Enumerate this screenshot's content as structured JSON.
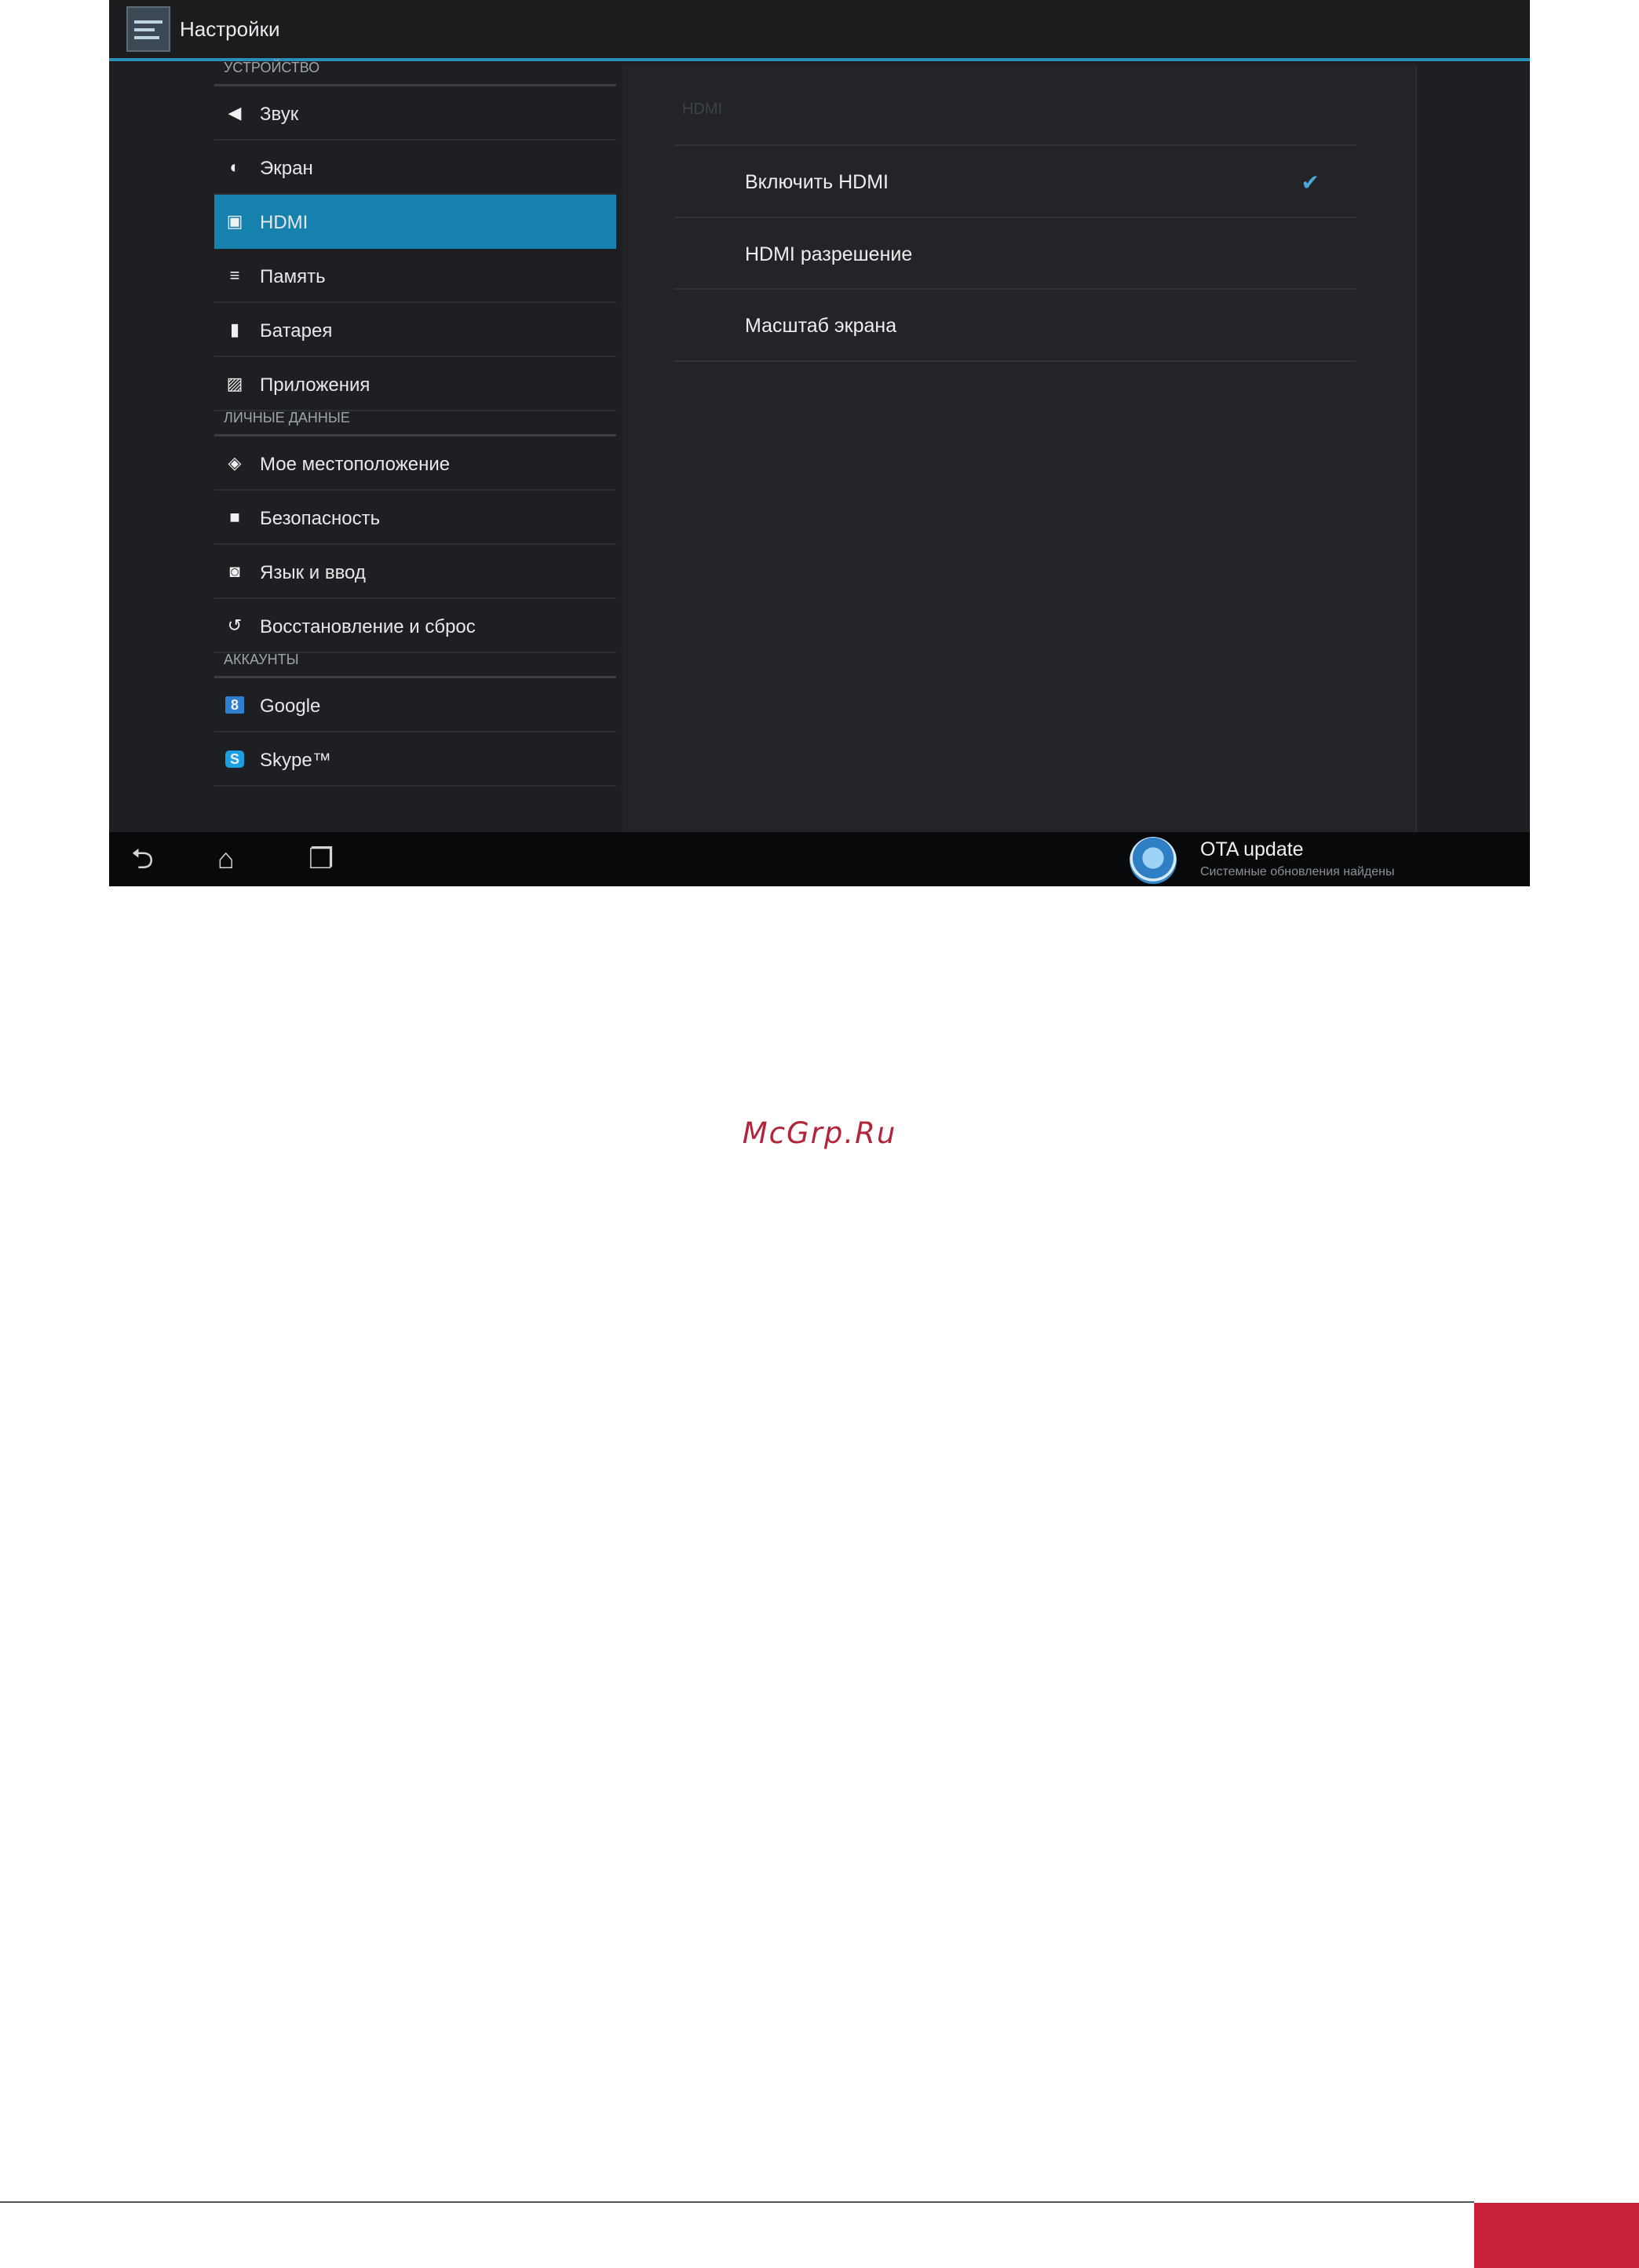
{
  "app": {
    "title": "Настройки"
  },
  "sidebar": {
    "sections": [
      {
        "label": "УСТРОЙСТВО"
      },
      {
        "label": "ЛИЧНЫЕ ДАННЫЕ"
      },
      {
        "label": "АККАУНТЫ"
      }
    ],
    "items": [
      {
        "label": "Звук",
        "icon": "volume-icon"
      },
      {
        "label": "Экран",
        "icon": "brightness-icon"
      },
      {
        "label": "HDMI",
        "icon": "hdmi-icon",
        "selected": true
      },
      {
        "label": "Память",
        "icon": "storage-icon"
      },
      {
        "label": "Батарея",
        "icon": "battery-icon"
      },
      {
        "label": "Приложения",
        "icon": "apps-icon"
      },
      {
        "label": "Мое местоположение",
        "icon": "location-icon"
      },
      {
        "label": "Безопасность",
        "icon": "lock-icon"
      },
      {
        "label": "Язык и ввод",
        "icon": "language-icon"
      },
      {
        "label": "Восстановление и сброс",
        "icon": "restore-icon"
      },
      {
        "label": "Google",
        "icon": "google-icon"
      },
      {
        "label": "Skype™",
        "icon": "skype-icon"
      }
    ]
  },
  "detail": {
    "header": "HDMI",
    "rows": [
      {
        "label": "Включить HDMI",
        "checked": true
      },
      {
        "label": "HDMI разрешение"
      },
      {
        "label": "Масштаб экрана"
      }
    ]
  },
  "notification": {
    "title": "OTA update",
    "subtitle": "Системные обновления найдены"
  },
  "watermark": "McGrp.Ru",
  "colors": {
    "accent": "#1681ad",
    "brand_red": "#c6203b",
    "watermark": "#b2253a"
  }
}
